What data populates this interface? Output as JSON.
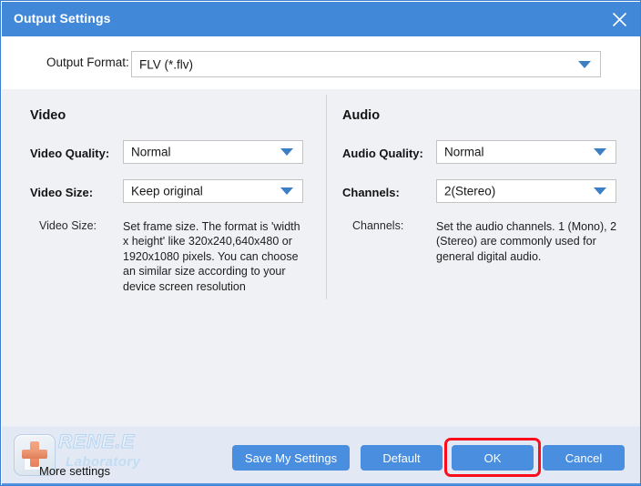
{
  "window": {
    "title": "Output Settings",
    "close_icon": "close-x-icon",
    "accent_color": "#4288d8",
    "panel_color": "#f0f1f5",
    "footer_color": "#e3e9f4",
    "highlight_color": "#fc0d1b"
  },
  "format": {
    "label": "Output Format:",
    "value": "FLV (*.flv)"
  },
  "video": {
    "section_title": "Video",
    "quality_label": "Video Quality:",
    "quality_value": "Normal",
    "size_label": "Video Size:",
    "size_value": "Keep original",
    "hint_label": "Video Size:",
    "hint_text": "Set frame size. The format is 'width x height' like 320x240,640x480 or 1920x1080 pixels. You can choose an similar size according to your device screen resolution"
  },
  "audio": {
    "section_title": "Audio",
    "quality_label": "Audio Quality:",
    "quality_value": "Normal",
    "channels_label": "Channels:",
    "channels_value": "2(Stereo)",
    "hint_label": "Channels:",
    "hint_text": "Set the audio channels. 1 (Mono), 2 (Stereo) are commonly used for general digital audio."
  },
  "footer": {
    "more_settings_label": "More settings",
    "more_settings_icon": "plus-cross-icon",
    "watermark_main": "RENE.E",
    "watermark_sub": "Laboratory",
    "buttons": {
      "save": "Save My Settings",
      "default": "Default",
      "ok": "OK",
      "cancel": "Cancel"
    }
  }
}
